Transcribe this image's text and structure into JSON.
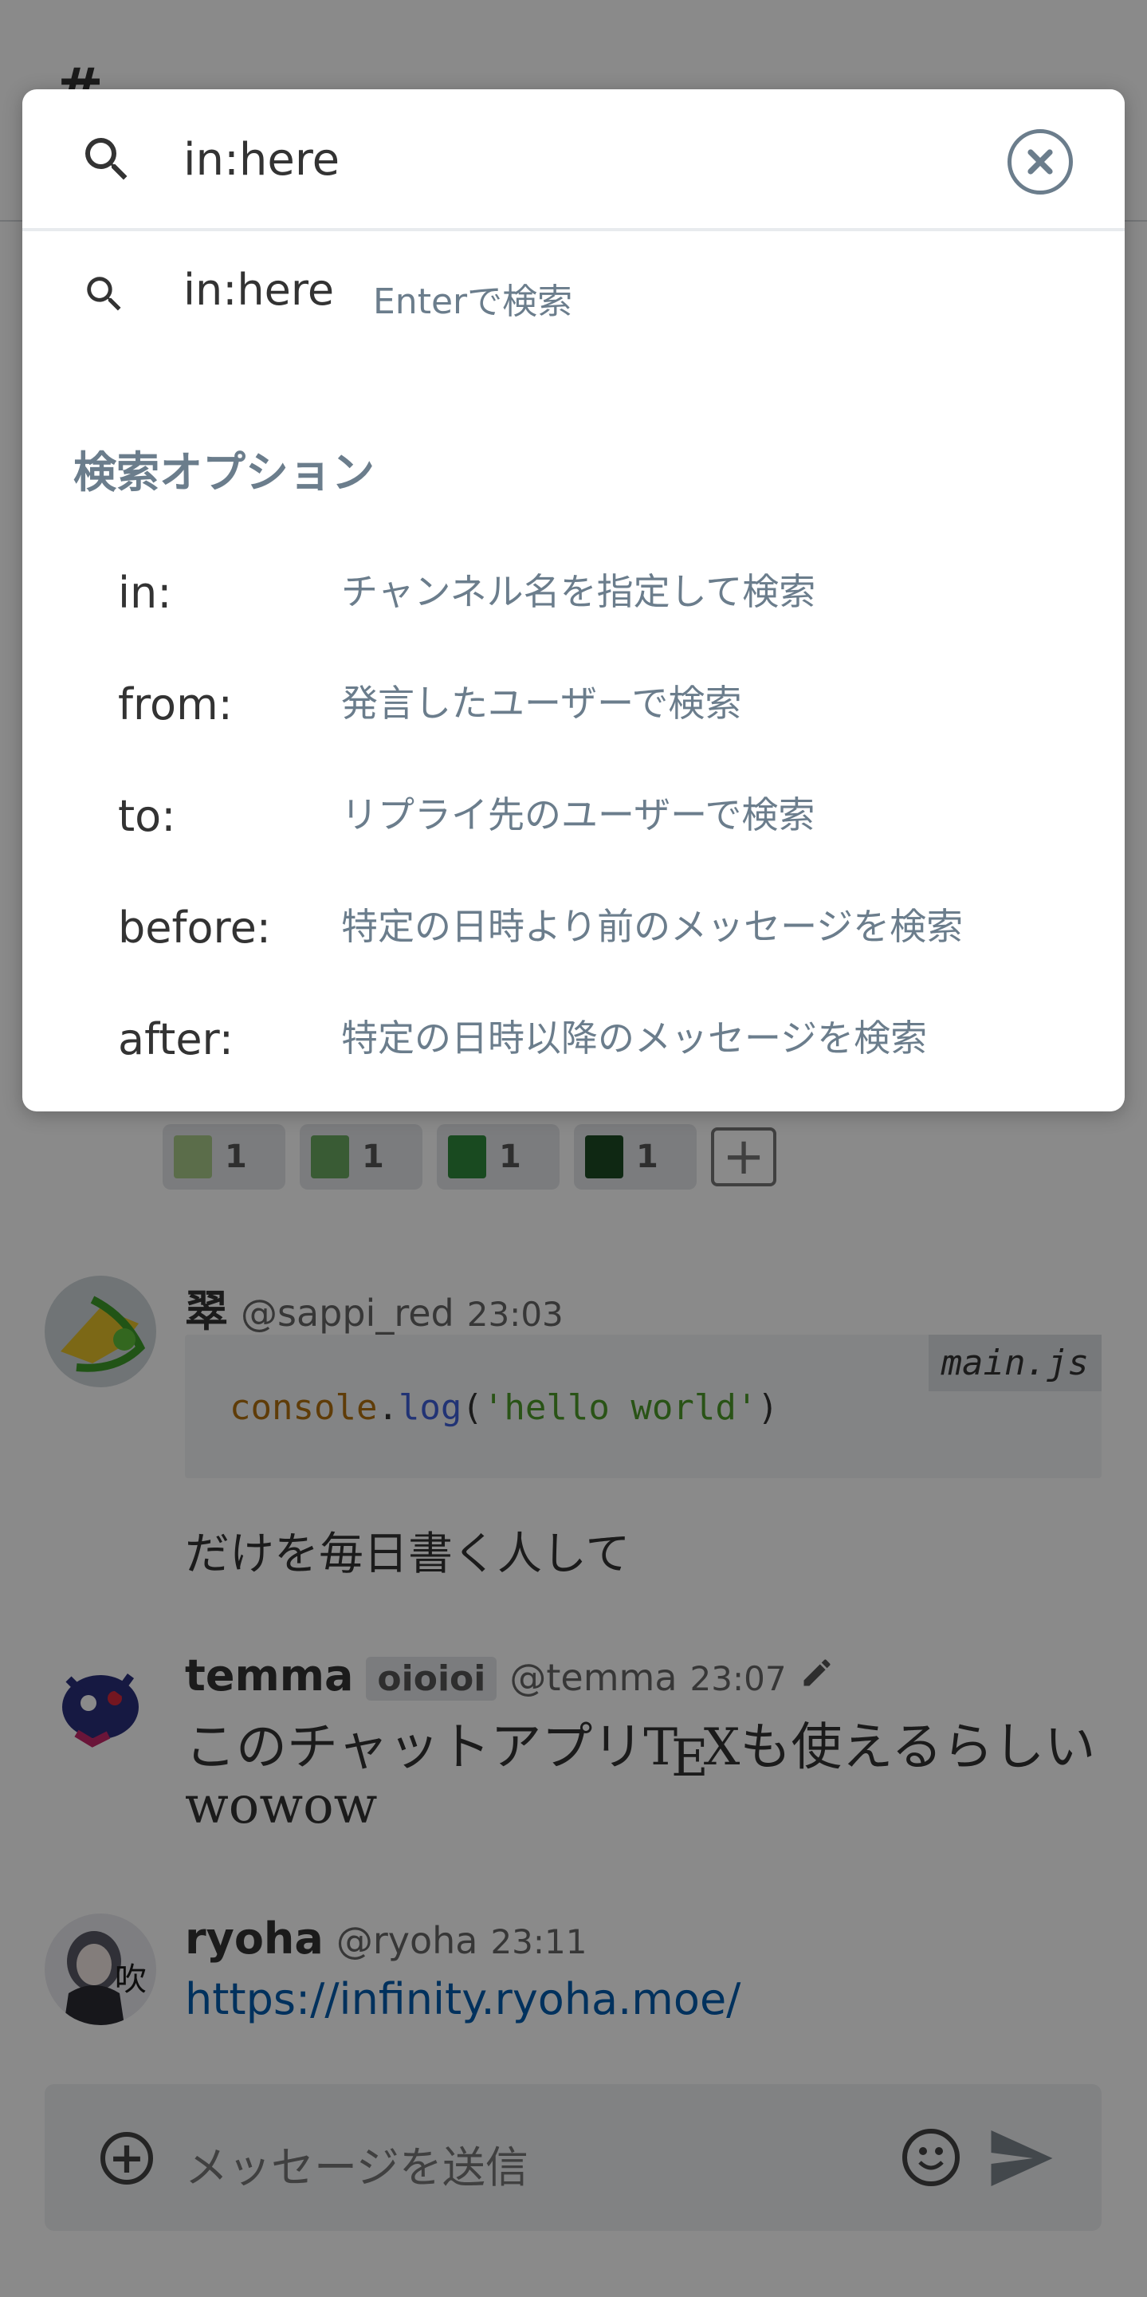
{
  "search": {
    "query": "in:here",
    "suggestion_query": "in:here",
    "suggestion_hint": "Enterで検索",
    "options_title": "検索オプション",
    "options": [
      {
        "key": "in:",
        "desc": "チャンネル名を指定して検索"
      },
      {
        "key": "from:",
        "desc": "発言したユーザーで検索"
      },
      {
        "key": "to:",
        "desc": "リプライ先のユーザーで検索"
      },
      {
        "key": "before:",
        "desc": "特定の日時より前のメッセージを検索"
      },
      {
        "key": "after:",
        "desc": "特定の日時以降のメッセージを検索"
      }
    ]
  },
  "stamps": [
    {
      "color": "#a9c98a",
      "count": "1"
    },
    {
      "color": "#6aa860",
      "count": "1"
    },
    {
      "color": "#2f8a3c",
      "count": "1"
    },
    {
      "color": "#1d4a24",
      "count": "1"
    }
  ],
  "messages": [
    {
      "name": "翠",
      "handle": "@sappi_red",
      "time": "23:03",
      "code_file": "main.js",
      "code_obj": "console",
      "code_dot": ".",
      "code_fn": "log",
      "code_open": "(",
      "code_str": "'hello world'",
      "code_close": ")",
      "text": "だけを毎日書く人して"
    },
    {
      "name": "temma",
      "tag": "oioioi",
      "handle": "@temma",
      "time": "23:07",
      "line1": "このチャットアプリ",
      "tex_t": "T",
      "tex_e": "E",
      "tex_x": "X",
      "line1_end": "も使えるらしい",
      "line2": "wowow"
    },
    {
      "name": "ryoha",
      "handle": "@ryoha",
      "time": "23:11",
      "link": "https://infinity.ryoha.moe/"
    }
  ],
  "composer": {
    "placeholder": "メッセージを送信"
  },
  "colors": {
    "overlay": "rgba(0,0,0,0.46)",
    "hint": "#6b7d8c",
    "link": "#005bac"
  }
}
